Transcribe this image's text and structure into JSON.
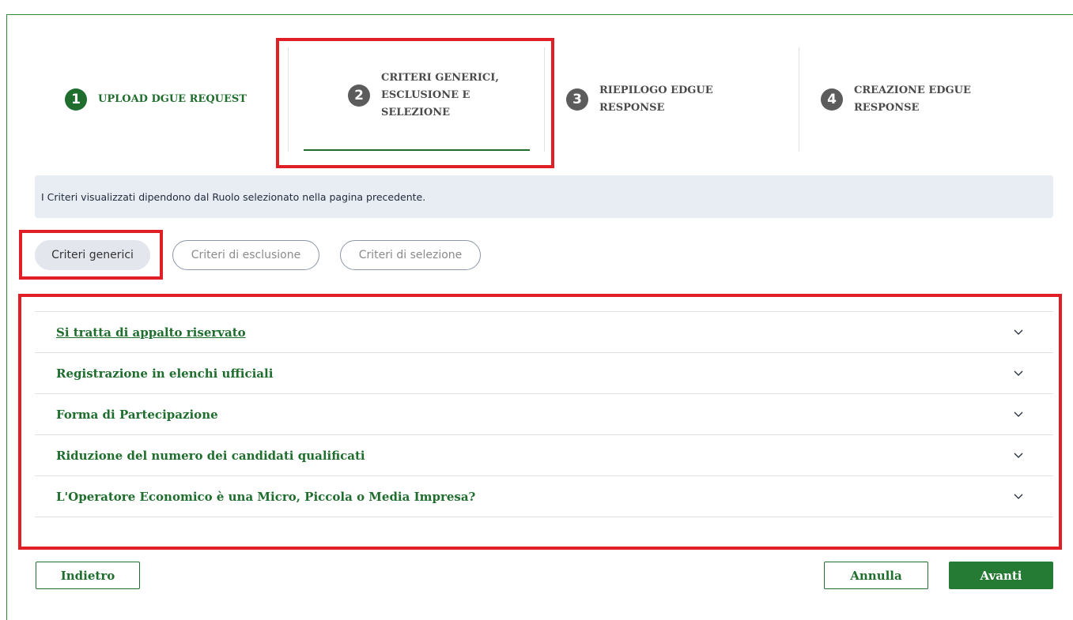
{
  "stepper": {
    "steps": [
      {
        "number": "1",
        "label": "UPLOAD DGUE REQUEST",
        "state": "completed"
      },
      {
        "number": "2",
        "label": "CRITERI GENERICI, ESCLUSIONE E SELEZIONE",
        "state": "active"
      },
      {
        "number": "3",
        "label": "RIEPILOGO EDGUE RESPONSE",
        "state": "pending"
      },
      {
        "number": "4",
        "label": "CREAZIONE EDGUE RESPONSE",
        "state": "pending"
      }
    ]
  },
  "info": {
    "text": "I Criteri visualizzati dipendono dal Ruolo selezionato nella pagina precedente."
  },
  "filters": {
    "tabs": [
      {
        "label": "Criteri generici",
        "active": true
      },
      {
        "label": "Criteri di esclusione",
        "active": false
      },
      {
        "label": "Criteri di selezione",
        "active": false
      }
    ]
  },
  "accordion": {
    "items": [
      {
        "title": "Si tratta di appalto riservato",
        "icon": "chevron-down-icon"
      },
      {
        "title": "Registrazione in elenchi ufficiali",
        "icon": "chevron-down-icon"
      },
      {
        "title": "Forma di Partecipazione",
        "icon": "chevron-down-icon"
      },
      {
        "title": "Riduzione del numero dei candidati qualificati",
        "icon": "chevron-down-icon"
      },
      {
        "title": "L'Operatore Economico è una Micro, Piccola o Media Impresa?",
        "icon": "chevron-down-icon"
      }
    ]
  },
  "actions": {
    "back_label": "Indietro",
    "cancel_label": "Annulla",
    "next_label": "Avanti"
  },
  "colors": {
    "primary_green": "#1f6e2e",
    "highlight_red": "#e01e26",
    "info_bg": "#e8ecf3"
  }
}
